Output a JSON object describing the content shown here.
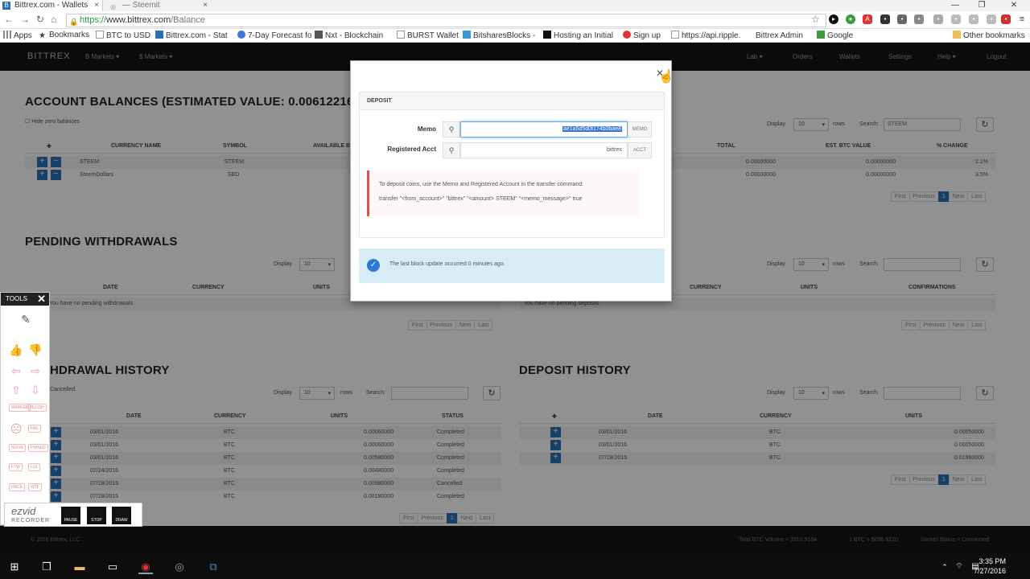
{
  "browser": {
    "tabs": [
      {
        "label": "Bittrex.com - Wallets"
      },
      {
        "label": "— Steemit"
      }
    ],
    "url_protocol": "https://",
    "url_host": "www.bittrex.com",
    "url_path": "/Balance",
    "bookmarks": [
      {
        "label": "Apps"
      },
      {
        "label": "Bookmarks"
      },
      {
        "label": "BTC to USD"
      },
      {
        "label": "Bittrex.com - Stat"
      },
      {
        "label": "7-Day Forecast fo"
      },
      {
        "label": "Nxt - Blockchain"
      },
      {
        "label": "BURST Wallet"
      },
      {
        "label": "BitsharesBlocks -"
      },
      {
        "label": "Hosting an Initial"
      },
      {
        "label": "Sign up"
      },
      {
        "label": "https://api.ripple."
      },
      {
        "label": "Bittrex Admin"
      },
      {
        "label": "Google"
      },
      {
        "label": "Other bookmarks"
      }
    ]
  },
  "navbar": {
    "brand": "BITTREX",
    "left": [
      "B Markets ▾",
      "$ Markets ▾"
    ],
    "right": [
      "Lab ▾",
      "Orders",
      "Wallets",
      "Settings",
      "Help ▾",
      "Logout"
    ]
  },
  "balances": {
    "title": "ACCOUNT BALANCES (ESTIMATED VALUE: 0.00612216 BT",
    "hide_zero": "Hide zero balances",
    "display_label": "Display",
    "display_value": "10",
    "rows_label": "rows",
    "search_label": "Search:",
    "search_value": "STEEM",
    "headers": [
      "CURRENCY NAME",
      "SYMBOL",
      "AVAILABLE B",
      "TOTAL",
      "EST. BTC VALUE",
      "% CHANGE"
    ],
    "rows": [
      {
        "name": "STEEM",
        "symbol": "STEEM",
        "total": "0.00000000",
        "btc": "0.00000000",
        "change": "2.1%"
      },
      {
        "name": "SteemDollars",
        "symbol": "SBD",
        "total": "0.00000000",
        "btc": "0.00000000",
        "change": "3.5%"
      }
    ],
    "pager": [
      "First",
      "Previous",
      "1",
      "Next",
      "Last"
    ]
  },
  "pending": {
    "title": "PENDING WITHDRAWALS",
    "display_label": "Display",
    "display_value": "10",
    "rows_label": "rows",
    "search_label": "Search:",
    "headers_left": [
      "DATE",
      "CURRENCY",
      "UNITS"
    ],
    "headers_right": [
      "CURRENCY",
      "UNITS",
      "CONFIRMATIONS"
    ],
    "empty_left": "You have no pending withdrawals.",
    "empty_right": "You have no pending deposits.",
    "pager": [
      "First",
      "Previous",
      "Next",
      "Last"
    ]
  },
  "withdrawal_history": {
    "title": "HDRAWAL HISTORY",
    "filter": "Cancelled",
    "display_label": "Display",
    "display_value": "10",
    "rows_label": "rows",
    "search_label": "Search:",
    "headers": [
      "DATE",
      "CURRENCY",
      "UNITS",
      "STATUS"
    ],
    "rows": [
      {
        "date": "03/01/2016",
        "currency": "BTC",
        "units": "0.00060000",
        "status": "Completed"
      },
      {
        "date": "03/01/2016",
        "currency": "BTC",
        "units": "0.00060000",
        "status": "Completed"
      },
      {
        "date": "03/01/2016",
        "currency": "BTC",
        "units": "0.00580000",
        "status": "Completed"
      },
      {
        "date": "02/24/2016",
        "currency": "BTC",
        "units": "0.00480000",
        "status": "Completed"
      },
      {
        "date": "07/28/2015",
        "currency": "BTC",
        "units": "0.00980000",
        "status": "Cancelled"
      },
      {
        "date": "07/28/2015",
        "currency": "BTC",
        "units": "0.00180000",
        "status": "Completed"
      }
    ],
    "pager": [
      "First",
      "Previous",
      "1",
      "Next",
      "Last"
    ]
  },
  "deposit_history": {
    "title": "DEPOSIT HISTORY",
    "display_label": "Display",
    "display_value": "10",
    "rows_label": "rows",
    "search_label": "Search:",
    "headers": [
      "DATE",
      "CURRENCY",
      "UNITS"
    ],
    "rows": [
      {
        "date": "03/01/2016",
        "currency": "BTC",
        "units": "0.00050000"
      },
      {
        "date": "03/01/2016",
        "currency": "BTC",
        "units": "0.00050000"
      },
      {
        "date": "07/28/2015",
        "currency": "BTC",
        "units": "0.01980000"
      }
    ],
    "pager": [
      "First",
      "Previous",
      "1",
      "Next",
      "Last"
    ]
  },
  "modal": {
    "panel_title": "DEPOSIT",
    "memo_label": "Memo",
    "memo_value": "ae1a5d5d0f174b0bae8",
    "memo_addon": "MEMO",
    "acct_label": "Registered Acct",
    "acct_value": "bittrex",
    "acct_addon": "ACCT",
    "alert_line1": "To deposit coins, use the Memo and Registered Account in the transfer command:",
    "alert_line2": "transfer \"<from_account>\" \"bittrex\" \"<amount> STEEM\" \"<memo_message>\" true",
    "info": "The last block update occurred 0 minutes ago."
  },
  "footer": {
    "copyright": "© 2016 Bittrex, LLC",
    "volume": "Total BTC Volume = 3310.5164",
    "price": "1 BTC = $656.6220",
    "socket": "Socket Status = Connected"
  },
  "tools": {
    "title": "TOOLS",
    "small_labels": [
      "MARKER",
      "BLUSH",
      "FAIL",
      "NOOB",
      "PWNED",
      "FTW",
      "LOL",
      "HACK",
      "WTF"
    ],
    "brand": "ezvid",
    "brand_sub": "RECORDER",
    "rec_buttons": [
      "PAUSE",
      "STOP",
      "DRAW"
    ]
  },
  "taskbar": {
    "time": "3:35 PM",
    "date": "7/27/2016"
  }
}
